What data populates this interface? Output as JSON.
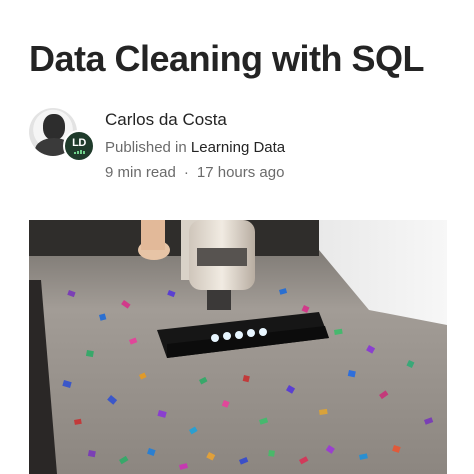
{
  "article": {
    "title": "Data Cleaning with SQL",
    "author": "Carlos da Costa",
    "published_prefix": "Published in",
    "publication": "Learning Data",
    "publication_logo_text": "LD",
    "read_time": "9 min read",
    "separator": "·",
    "posted": "17 hours ago"
  },
  "icons": {
    "author_avatar": "author-avatar-icon",
    "publication_logo": "publication-logo-icon"
  },
  "colors": {
    "text_primary": "#242424",
    "text_secondary": "#6b6b6b",
    "publication_logo_bg": "#1f3b2b",
    "publication_logo_accent": "#6fd18b"
  }
}
